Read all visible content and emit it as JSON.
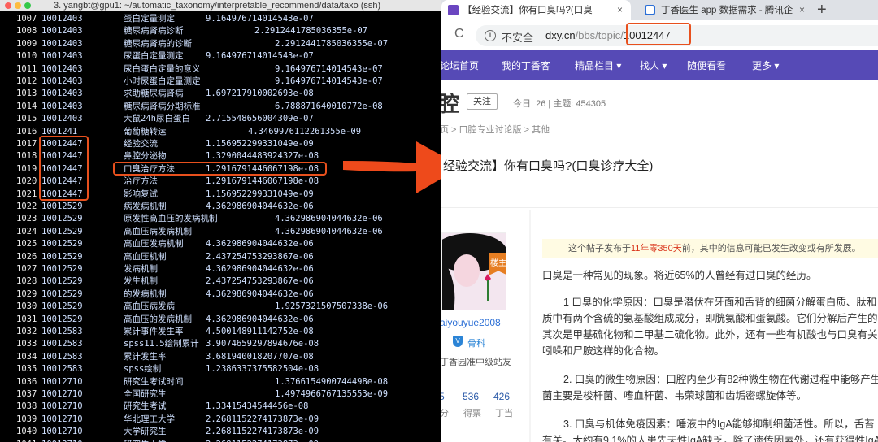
{
  "terminal": {
    "window_title": "3. yangbt@gpu1: ~/automatic_taxonomy/interpretable_recommend/data/taxo (ssh)",
    "rows": [
      {
        "n": "1007",
        "id": "10012403",
        "term": "蛋白定量测定",
        "score": "9.164976714014543e-07"
      },
      {
        "n": "1008",
        "id": "10012403",
        "term": "糖尿病肾病诊断",
        "score": "2.2912441785036355e-07"
      },
      {
        "n": "1009",
        "id": "10012403",
        "term": "糖尿病肾病的诊断",
        "score": "2.2912441785036355e-07"
      },
      {
        "n": "1010",
        "id": "10012403",
        "term": "尿蛋白定量测定",
        "score": "9.164976714014543e-07"
      },
      {
        "n": "1011",
        "id": "10012403",
        "term": "尿白蛋白定量的意义",
        "score": "9.164976714014543e-07"
      },
      {
        "n": "1012",
        "id": "10012403",
        "term": "小时尿蛋白定量测定",
        "score": "9.164976714014543e-07"
      },
      {
        "n": "1013",
        "id": "10012403",
        "term": "求助糖尿病肾病",
        "score": "1.697217910002693e-08"
      },
      {
        "n": "1014",
        "id": "10012403",
        "term": "糖尿病肾病分期标准",
        "score": "6.788871640010772e-08"
      },
      {
        "n": "1015",
        "id": "10012403",
        "term": "大鼠24h尿白蛋白",
        "score": "2.715548656004309e-07"
      },
      {
        "n": "1016",
        "id": "1001241",
        "term": "葡萄糖转运",
        "score": "4.3469976112261355e-09"
      },
      {
        "n": "1017",
        "id": "10012447",
        "term": "经验交流",
        "score": "1.156952299331049e-09"
      },
      {
        "n": "1018",
        "id": "10012447",
        "term": "鼻腔分泌物",
        "score": "1.3290044483924327e-08"
      },
      {
        "n": "1019",
        "id": "10012447",
        "term": "口臭治疗方法",
        "score": "1.2916791446067198e-08"
      },
      {
        "n": "1020",
        "id": "10012447",
        "term": "治疗方法",
        "score": "1.2916791446067198e-08"
      },
      {
        "n": "1021",
        "id": "10012447",
        "term": "影响复试",
        "score": "1.156952299331049e-09"
      },
      {
        "n": "1022",
        "id": "10012529",
        "term": "病发病机制",
        "score": "4.362986904044632e-06"
      },
      {
        "n": "1023",
        "id": "10012529",
        "term": "原发性高血压的发病机制",
        "score": "4.362986904044632e-06"
      },
      {
        "n": "1024",
        "id": "10012529",
        "term": "高血压病发病机制",
        "score": "4.362986904044632e-06"
      },
      {
        "n": "1025",
        "id": "10012529",
        "term": "高血压发病机制",
        "score": "4.362986904044632e-06"
      },
      {
        "n": "1026",
        "id": "10012529",
        "term": "高血压机制",
        "score": "2.437254753293867e-06"
      },
      {
        "n": "1027",
        "id": "10012529",
        "term": "发病机制",
        "score": "4.362986904044632e-06"
      },
      {
        "n": "1028",
        "id": "10012529",
        "term": "发生机制",
        "score": "2.437254753293867e-06"
      },
      {
        "n": "1029",
        "id": "10012529",
        "term": "的发病机制",
        "score": "4.362986904044632e-06"
      },
      {
        "n": "1030",
        "id": "10012529",
        "term": "高血压病发病",
        "score": "1.9257321507507338e-06"
      },
      {
        "n": "1031",
        "id": "10012529",
        "term": "高血压的发病机制",
        "score": "4.362986904044632e-06"
      },
      {
        "n": "1032",
        "id": "10012583",
        "term": "累计事件发生率",
        "score": "4.500148911142752e-08"
      },
      {
        "n": "1033",
        "id": "10012583",
        "term": "spss11.5绘制累计",
        "score": "3.9074659297894676e-08"
      },
      {
        "n": "1034",
        "id": "10012583",
        "term": "累计发生率",
        "score": "3.681940018207707e-08"
      },
      {
        "n": "1035",
        "id": "10012583",
        "term": "spss绘制",
        "score": "1.2386337375582504e-08"
      },
      {
        "n": "1036",
        "id": "10012710",
        "term": "研究生考试时间",
        "score": "1.3766154900744498e-08"
      },
      {
        "n": "1037",
        "id": "10012710",
        "term": "全国研究生",
        "score": "1.4974966767135553e-09"
      },
      {
        "n": "1038",
        "id": "10012710",
        "term": "研究生考试",
        "score": "1.33415434544456e-08"
      },
      {
        "n": "1039",
        "id": "10012710",
        "term": "华北理工大学",
        "score": "2.2681152274173873e-09"
      },
      {
        "n": "1040",
        "id": "10012710",
        "term": "大学研究生",
        "score": "2.2681152274173873e-09"
      },
      {
        "n": "1041",
        "id": "10012710",
        "term": "研究生大学",
        "score": "2.2681152274173873e-09"
      }
    ]
  },
  "browser": {
    "tabs": [
      {
        "label": "【经验交流】你有口臭吗?(口臭",
        "close": "×"
      },
      {
        "label": "丁香医生 app 数据需求 - 腾讯企",
        "close": "×"
      }
    ],
    "new_tab": "+",
    "reload": "C",
    "address": {
      "info": "i",
      "security": "不安全",
      "domain": "dxy.cn",
      "path": "/bbs/topic/",
      "id": "10012447"
    },
    "nav": [
      "论坛首页",
      "我的丁香客",
      "精品栏目 ▾",
      "找人 ▾",
      "随便看看",
      "更多 ▾"
    ],
    "forum": {
      "name": "腔",
      "follow": "关注",
      "stats": "今日: 26  |  主题: 454305",
      "breadcrumb": "页 > 口腔专业讨论版 > 其他"
    },
    "thread_title": "经验交流】你有口臭吗?(口臭诊疗大全)",
    "author": {
      "badge": "楼主",
      "username": "aiyouyue2008",
      "v": "V",
      "dept": "骨科",
      "level": "丁香园准中级站友",
      "stats": [
        {
          "value": "5",
          "label": "分"
        },
        {
          "value": "536",
          "label": "得票"
        },
        {
          "value": "426",
          "label": "丁当"
        }
      ]
    },
    "post": {
      "notice_prefix": "这个帖子发布于",
      "notice_age": "11年零350天",
      "notice_suffix": "前，其中的信息可能已发生改变或有所发展。",
      "paragraphs": [
        "口臭是一种常见的现象。将近65%的人曾经有过口臭的经历。",
        "1 口臭的化学原因：口臭是潜伏在牙面和舌背的细菌分解蛋白质、肽和",
        "质中有两个含硫的氨基酸组成成分，即胱氨酸和蛋氨酸。它们分解后产生的",
        "其次是甲基硫化物和二甲基二硫化物。此外，还有一些有机酸也与口臭有关",
        "吲哚和尸胺这样的化合物。",
        "2. 口臭的微生物原因：口腔内至少有82种微生物在代谢过程中能够产生",
        "菌主要是梭杆菌、嗜血杆菌、韦荣球菌和齿垢密螺旋体等。",
        "3. 口臭与机体免疫因素：唾液中的IgA能够抑制细菌活性。所以，舌苔",
        "有关。大约有9.1%的人患先天性IgA缺乏，除了遗传因素外，还有获得性IgA"
      ]
    }
  },
  "colors": {
    "highlight": "#e8501d",
    "nav": "#564ab6",
    "link": "#2b6fd6"
  }
}
